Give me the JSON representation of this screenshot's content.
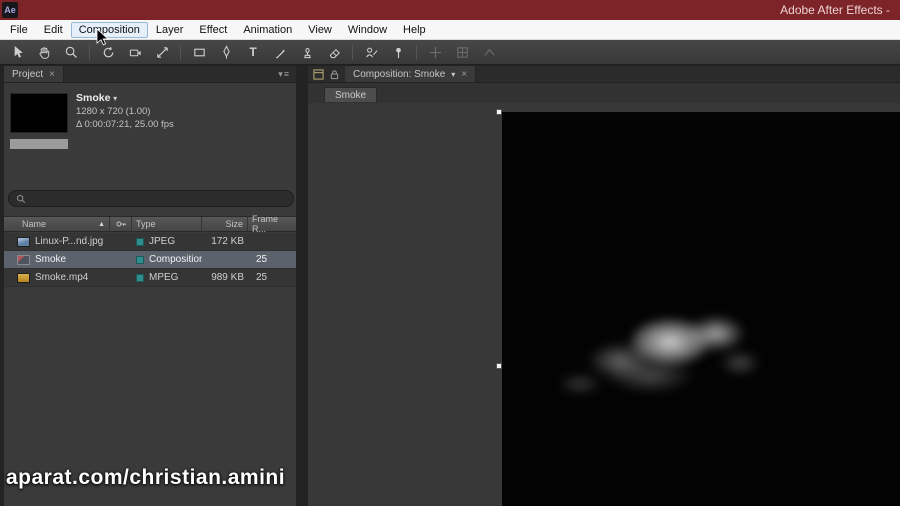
{
  "titlebar": {
    "app_icon_label": "Ae",
    "title": "Adobe After Effects -"
  },
  "menubar": {
    "items": [
      "File",
      "Edit",
      "Composition",
      "Layer",
      "Effect",
      "Animation",
      "View",
      "Window",
      "Help"
    ],
    "highlighted": "Composition"
  },
  "toolbar": {
    "tools": [
      "selection",
      "hand",
      "zoom",
      "rotation",
      "camera",
      "pan-behind",
      "rectangle",
      "pen",
      "type",
      "brush",
      "clone-stamp",
      "eraser",
      "roto-brush",
      "puppet-pin"
    ],
    "type_tool_glyph": "T"
  },
  "project_panel": {
    "tab_label": "Project",
    "tab_close_glyph": "×",
    "panel_menu_glyph": "▾≡",
    "item": {
      "name": "Smoke",
      "dropdown_glyph": "▾",
      "resolution": "1280 x 720 (1.00)",
      "duration": "Δ 0:00:07:21, 25.00 fps"
    },
    "search": {
      "value": "",
      "placeholder": ""
    },
    "table": {
      "sort_glyph": "▲",
      "columns": {
        "name": "Name",
        "type": "Type",
        "size": "Size",
        "frame_rate": "Frame R..."
      },
      "rows": [
        {
          "name": "Linux-P...nd.jpg",
          "type": "JPEG",
          "size": "172 KB",
          "frame_rate": ""
        },
        {
          "name": "Smoke",
          "type": "Composition",
          "size": "",
          "frame_rate": "25"
        },
        {
          "name": "Smoke.mp4",
          "type": "MPEG",
          "size": "989 KB",
          "frame_rate": "25"
        }
      ]
    }
  },
  "composition_panel": {
    "tab_label": "Composition: Smoke",
    "dropdown_glyph": "▾",
    "tab_close_glyph": "×",
    "viewer_tab_label": "Smoke"
  },
  "watermark": "aparat.com/christian.amini",
  "colors": {
    "titlebar_bg": "#7d2428",
    "menubar_bg": "#f7f7f7",
    "toolbar_bg": "#3d3d3d",
    "panel_bg": "#3a3a3a",
    "selected_row_bg": "#5b626b",
    "comp_bg": "#030303",
    "label_chip": "#2f8f8f"
  }
}
